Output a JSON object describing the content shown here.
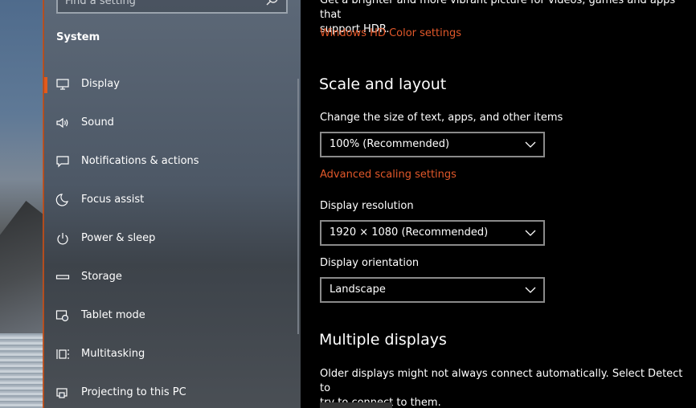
{
  "search": {
    "placeholder": "Find a setting"
  },
  "nav": {
    "section_title": "System",
    "items": [
      {
        "label": "Display",
        "icon": "monitor-icon",
        "selected": true
      },
      {
        "label": "Sound",
        "icon": "speaker-icon"
      },
      {
        "label": "Notifications & actions",
        "icon": "message-icon"
      },
      {
        "label": "Focus assist",
        "icon": "moon-icon"
      },
      {
        "label": "Power & sleep",
        "icon": "power-icon"
      },
      {
        "label": "Storage",
        "icon": "storage-icon"
      },
      {
        "label": "Tablet mode",
        "icon": "tablet-mode-icon"
      },
      {
        "label": "Multitasking",
        "icon": "multitasking-icon"
      },
      {
        "label": "Projecting to this PC",
        "icon": "projector-icon"
      }
    ]
  },
  "content": {
    "hdr_text_line1": "Get a brighter and more vibrant picture for videos, games and apps that",
    "hdr_text_line2": "support HDR.",
    "hdr_link": "Windows HD Color settings",
    "scale_heading": "Scale and layout",
    "scale_label": "Change the size of text, apps, and other items",
    "scale_value": "100% (Recommended)",
    "advanced_link": "Advanced scaling settings",
    "resolution_label": "Display resolution",
    "resolution_value": "1920 × 1080 (Recommended)",
    "orientation_label": "Display orientation",
    "orientation_value": "Landscape",
    "multi_heading": "Multiple displays",
    "multi_text_line1": "Older displays might not always connect automatically. Select Detect to",
    "multi_text_line2": "try to connect to them."
  },
  "colors": {
    "accent": "#E35A1C",
    "link": "#E2582A",
    "content_bg": "#000000"
  }
}
